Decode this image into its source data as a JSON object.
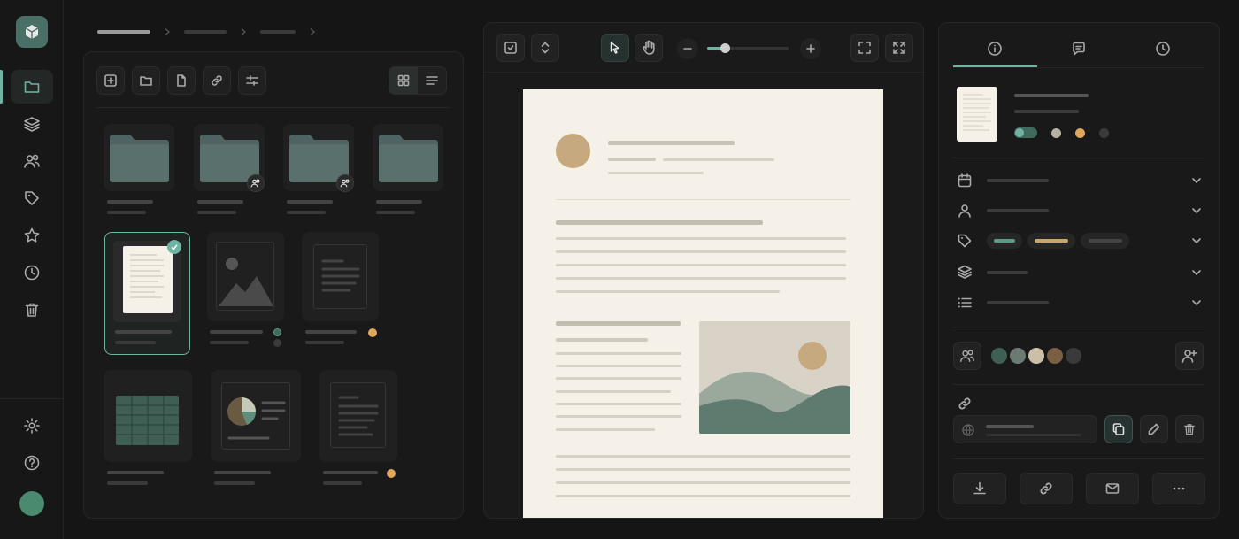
{
  "colors": {
    "accent": "#6fb3a3",
    "background": "#151515",
    "panel": "#191919",
    "paper": "#f5f0e8",
    "folder": "#4f6462",
    "tag_green": "#5b9c86",
    "tag_tan": "#c9a46b",
    "status_orange": "#e2a75a"
  },
  "sidebar": {
    "logo": "cube-logo-icon",
    "items": [
      {
        "icon": "folder-icon",
        "active": true
      },
      {
        "icon": "layers-icon",
        "active": false
      },
      {
        "icon": "users-icon",
        "active": false
      },
      {
        "icon": "tag-icon",
        "active": false
      },
      {
        "icon": "star-icon",
        "active": false
      },
      {
        "icon": "clock-icon",
        "active": false
      },
      {
        "icon": "trash-icon",
        "active": false
      }
    ],
    "bottom": [
      "gear-icon",
      "help-icon",
      "avatar"
    ]
  },
  "breadcrumb": {
    "levels": 3
  },
  "file_panel": {
    "toolbar": [
      "new-file-icon",
      "folder-icon",
      "document-icon",
      "link-icon",
      "sliders-icon"
    ],
    "view_modes": [
      {
        "icon": "grid-icon",
        "active": true
      },
      {
        "icon": "list-icon",
        "active": false
      }
    ],
    "folders": [
      {
        "shared": false
      },
      {
        "shared": true
      },
      {
        "shared": true
      },
      {
        "shared": false
      }
    ],
    "files": [
      {
        "type": "document",
        "selected": true
      },
      {
        "type": "image",
        "status": "shared"
      },
      {
        "type": "document",
        "status": "orange"
      },
      {
        "type": "spreadsheet"
      },
      {
        "type": "chart"
      },
      {
        "type": "document",
        "status": "orange"
      }
    ]
  },
  "preview": {
    "toolbar_left": [
      "fit-page-icon",
      "expand-icon"
    ],
    "tools": [
      {
        "icon": "cursor-icon",
        "active": true
      },
      {
        "icon": "hand-icon",
        "active": false
      }
    ],
    "zoom_level": 0.22,
    "toolbar_right": [
      "fit-width-icon",
      "fullscreen-icon"
    ]
  },
  "info_panel": {
    "tabs": [
      {
        "icon": "info-icon",
        "active": true
      },
      {
        "icon": "comment-icon",
        "active": false
      },
      {
        "icon": "history-icon",
        "active": false
      }
    ],
    "properties": [
      "calendar-icon",
      "person-icon",
      "tag-icon",
      "layers-icon",
      "list-icon"
    ],
    "collaborators": 5,
    "actions": [
      "download-icon",
      "link-icon",
      "mail-icon",
      "more-icon"
    ]
  }
}
